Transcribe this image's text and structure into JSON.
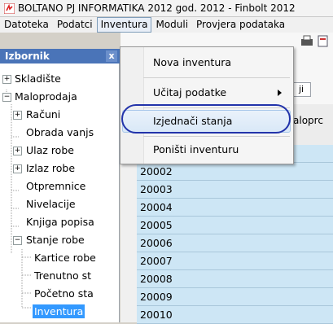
{
  "window": {
    "title": "BOLTANO PJ INFORMATIKA 2012 god. 2012 - Finbolt 2012"
  },
  "menubar": {
    "items": [
      "Datoteka",
      "Podatci",
      "Inventura",
      "Moduli",
      "Provjera podataka"
    ],
    "active": "Inventura"
  },
  "sidebar": {
    "title": "Izbornik",
    "close_label": "x",
    "items": [
      {
        "label": "Skladište",
        "level": 0,
        "expander": "+"
      },
      {
        "label": "Maloprodaja",
        "level": 0,
        "expander": "-"
      },
      {
        "label": "Računi",
        "level": 1,
        "expander": "+"
      },
      {
        "label": "Obrada vanjs",
        "level": 1,
        "expander": ""
      },
      {
        "label": "Ulaz robe",
        "level": 1,
        "expander": "+"
      },
      {
        "label": "Izlaz robe",
        "level": 1,
        "expander": "+"
      },
      {
        "label": "Otpremnice",
        "level": 1,
        "expander": ""
      },
      {
        "label": "Nivelacije",
        "level": 1,
        "expander": ""
      },
      {
        "label": "Knjiga popisa",
        "level": 1,
        "expander": ""
      },
      {
        "label": "Stanje robe",
        "level": 1,
        "expander": "-"
      },
      {
        "label": "Kartice robe",
        "level": 2,
        "expander": ""
      },
      {
        "label": "Trenutno st",
        "level": 2,
        "expander": ""
      },
      {
        "label": "Početno sta",
        "level": 2,
        "expander": ""
      },
      {
        "label": "Inventura",
        "level": 2,
        "expander": "",
        "selected": true
      }
    ]
  },
  "dropdown": {
    "items": [
      {
        "label": "Nova inventura"
      },
      {
        "label": "Učitaj podatke",
        "submenu": true
      },
      {
        "label": "Izjednači stanja",
        "highlighted": true
      },
      {
        "label": "Poništi inventuru"
      }
    ]
  },
  "main": {
    "tab_label": "ji",
    "column_header": "aloprc",
    "rows": [
      "20002",
      "20003",
      "20004",
      "20005",
      "20006",
      "20007",
      "20008",
      "20009",
      "20010"
    ]
  },
  "colors": {
    "accent": "#3399ff",
    "sidebar_header": "#4a74b8",
    "row_bg": "#cde6f5",
    "annotation": "#2233aa"
  }
}
